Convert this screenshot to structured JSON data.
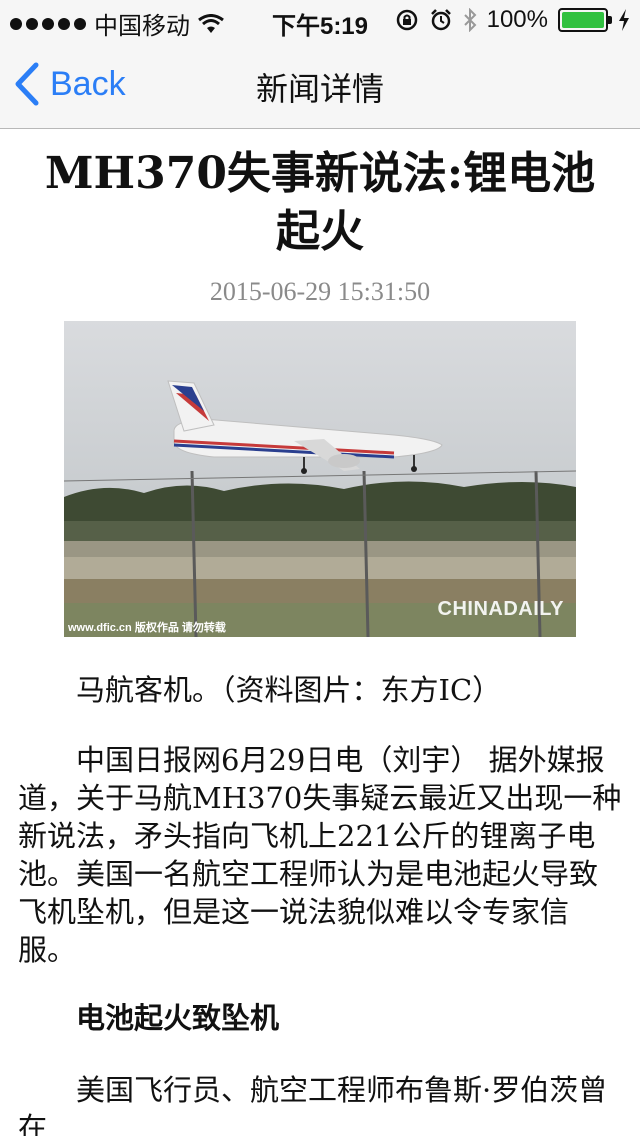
{
  "status_bar": {
    "carrier": "中国移动",
    "time": "下午5:19",
    "battery_text": "100%",
    "battery_level": 1.0,
    "icons": [
      "signal-dots-icon",
      "wifi-icon",
      "rotation-lock-icon",
      "alarm-icon",
      "bluetooth-icon",
      "battery-icon",
      "charging-icon"
    ]
  },
  "nav": {
    "back_label": "Back",
    "title": "新闻详情"
  },
  "article": {
    "headline": "MH370失事新说法:锂电池起火",
    "date": "2015-06-29 15:31:50",
    "photo": {
      "credit_left": "www.dfic.cn 版权作品 请勿转载",
      "credit_right": "CHINADAILY"
    },
    "caption": "马航客机。（资料图片：东方IC）",
    "paragraph1": "中国日报网6月29日电（刘宇） 据外媒报道，关于马航MH370失事疑云最近又出现一种新说法，矛头指向飞机上221公斤的锂离子电池。美国一名航空工程师认为是电池起火导致飞机坠机，但是这一说法貌似难以令专家信服。",
    "subheading": "电池起火致坠机",
    "paragraph2": "美国飞行员、航空工程师布鲁斯·罗伯茨曾在"
  },
  "colors": {
    "accent": "#2b7ef6",
    "bar_bg": "#f6f6f6",
    "date_gray": "#8a8a8a",
    "battery_green": "#31c140"
  }
}
